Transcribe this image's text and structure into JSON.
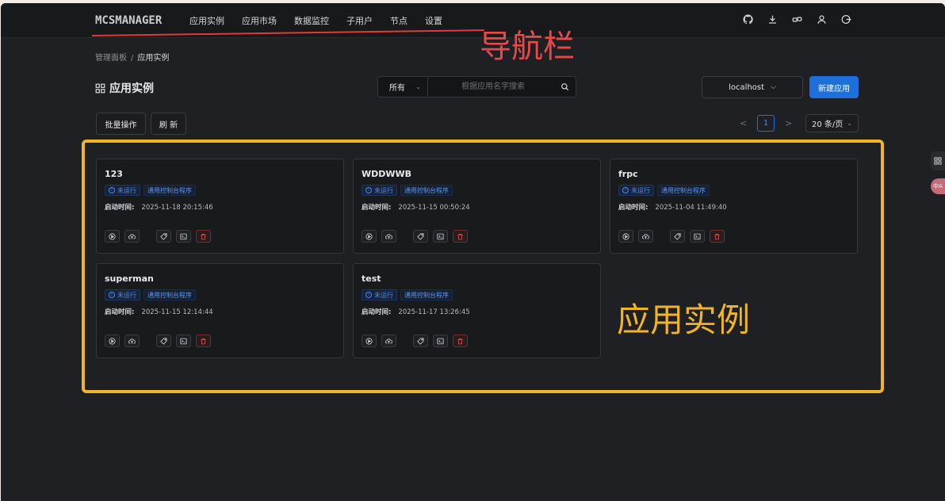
{
  "nav": {
    "logo": "MCSMANAGER",
    "items": [
      "应用实例",
      "应用市场",
      "数据监控",
      "子用户",
      "节点",
      "设置"
    ],
    "icons": [
      "github-icon",
      "download-icon",
      "link-icon",
      "user-icon",
      "logout-icon"
    ]
  },
  "annotations": {
    "nav_label": "导航栏",
    "instances_label": "应用实例",
    "nav_color": "#e23a3a",
    "box_color": "#f0b429"
  },
  "breadcrumb": {
    "parent": "管理面板",
    "separator": "/",
    "current": "应用实例"
  },
  "page": {
    "title": "应用实例"
  },
  "search": {
    "scope": "所有",
    "placeholder": "根据应用名字搜索",
    "value": ""
  },
  "node_select": {
    "value": "localhost"
  },
  "buttons": {
    "new_app": "新建应用",
    "batch": "批量操作",
    "refresh": "刷 新"
  },
  "pagination": {
    "prev": "<",
    "next": ">",
    "current_page": "1",
    "page_size": "20 条/页"
  },
  "instance_fields": {
    "start_label": "启动时间:"
  },
  "instances": [
    {
      "name": "123",
      "status": "未运行",
      "type": "通用控制台程序",
      "start_time": "2025-11-18 20:15:46"
    },
    {
      "name": "WDDWWB",
      "status": "未运行",
      "type": "通用控制台程序",
      "start_time": "2025-11-15 00:50:24"
    },
    {
      "name": "frpc",
      "status": "未运行",
      "type": "通用控制台程序",
      "start_time": "2025-11-04 11:49:40"
    },
    {
      "name": "superman",
      "status": "未运行",
      "type": "通用控制台程序",
      "start_time": "2025-11-15 12:14:44"
    },
    {
      "name": "test",
      "status": "未运行",
      "type": "通用控制台程序",
      "start_time": "2025-11-17 13:26:45"
    }
  ],
  "side": {
    "lang_badge": "中A"
  },
  "colors": {
    "accent": "#1f6fdb",
    "background": "#1f2023",
    "danger": "#e25555"
  }
}
